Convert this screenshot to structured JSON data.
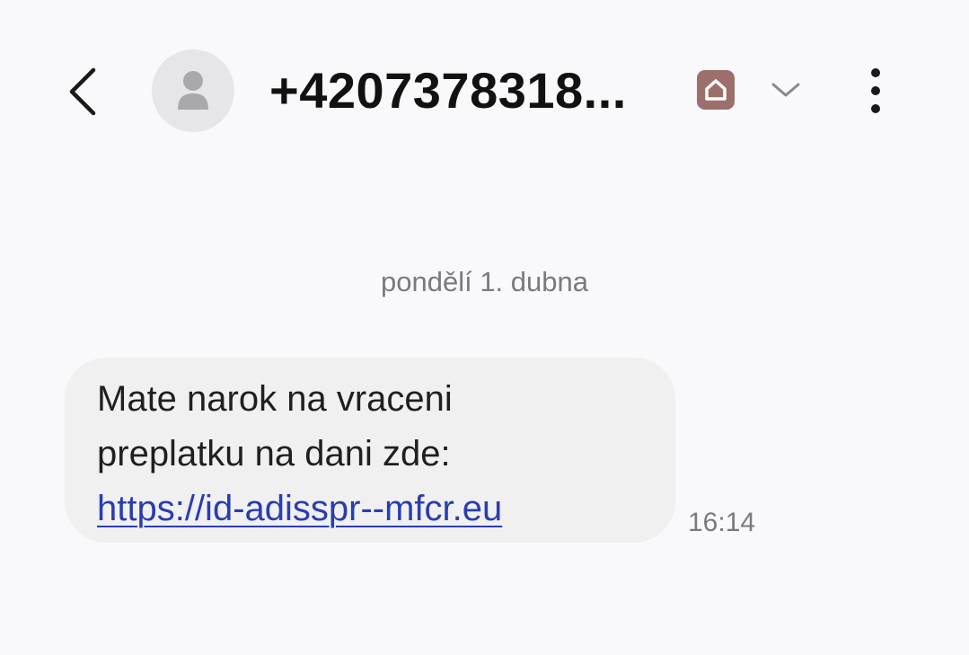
{
  "header": {
    "back_icon": "chevron-left-icon",
    "avatar_icon": "person-icon",
    "contact_name": "+4207378318...",
    "home_icon": "home-icon",
    "home_badge_color": "#9c6f6c",
    "expand_icon": "chevron-down-icon",
    "more_icon": "more-vertical-icon"
  },
  "conversation": {
    "date_separator": "pondělí 1. dubna",
    "messages": [
      {
        "lines": [
          "Mate narok na vraceni",
          "preplatku na dani zde:"
        ],
        "link": "https://id-adisspr--mfcr.eu",
        "time": "16:14"
      }
    ]
  },
  "colors": {
    "background": "#f9f9fb",
    "bubble": "#f0f0f1",
    "link": "#2a3db0",
    "secondary_text": "#7a7a7c"
  }
}
